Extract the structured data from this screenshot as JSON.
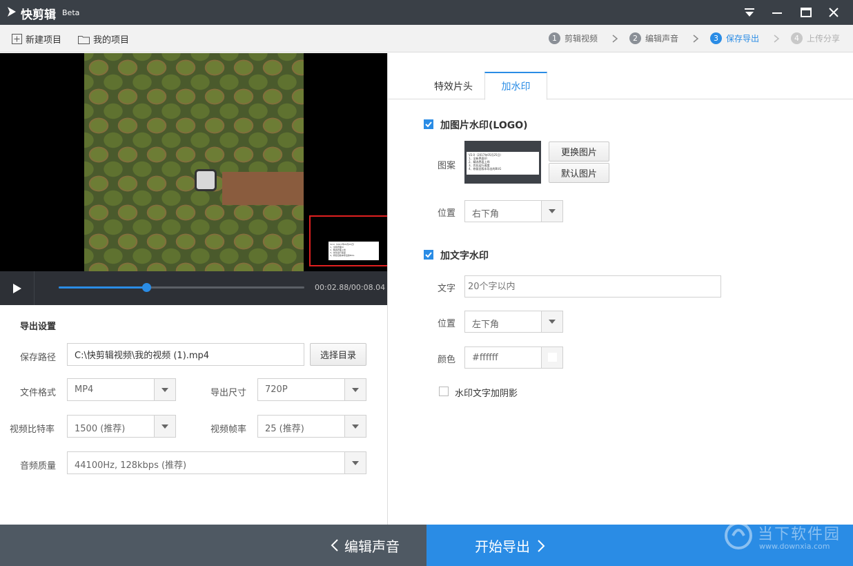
{
  "app": {
    "name": "快剪辑",
    "badge": "Beta"
  },
  "toolbar": {
    "new_project": "新建项目",
    "my_projects": "我的项目",
    "steps": [
      {
        "num": "1",
        "label": "剪辑视频"
      },
      {
        "num": "2",
        "label": "编辑声音"
      },
      {
        "num": "3",
        "label": "保存导出"
      },
      {
        "num": "4",
        "label": "上传分享"
      }
    ]
  },
  "player": {
    "time": "00:02.88/00:08.04",
    "progress": 0.358,
    "watermark_text": "V2.0（2017年05月25日）\n1、全新界面UI\n2、精选界面上线\n3、优化运行速度\n4、修复旧版本导出的BUG"
  },
  "export_settings": {
    "title": "导出设置",
    "save_path_label": "保存路径",
    "save_path_value": "C:\\快剪辑视频\\我的视频 (1).mp4",
    "choose_dir": "选择目录",
    "format_label": "文件格式",
    "format_value": "MP4",
    "size_label": "导出尺寸",
    "size_value": "720P",
    "bitrate_label": "视频比特率",
    "bitrate_value": "1500 (推荐)",
    "framerate_label": "视频帧率",
    "framerate_value": "25 (推荐)",
    "audio_label": "音频质量",
    "audio_value": "44100Hz, 128kbps (推荐)"
  },
  "tabs": {
    "intro": "特效片头",
    "watermark": "加水印"
  },
  "image_watermark": {
    "enabled_label": "加图片水印(LOGO)",
    "pattern_label": "图案",
    "replace": "更换图片",
    "default": "默认图片",
    "position_label": "位置",
    "position_value": "右下角"
  },
  "text_watermark": {
    "enabled_label": "加文字水印",
    "text_label": "文字",
    "text_placeholder": "20个字以内",
    "position_label": "位置",
    "position_value": "左下角",
    "color_label": "颜色",
    "color_value": "#ffffff",
    "shadow_label": "水印文字加阴影"
  },
  "bottom": {
    "back_label": "编辑声音",
    "export_label": "开始导出"
  },
  "site_watermark": {
    "name": "当下软件园",
    "url": "www.downxia.com"
  },
  "colors": {
    "accent": "#2a8ce5",
    "titlebar": "#3a4047",
    "bottombar": "#4f5963"
  }
}
